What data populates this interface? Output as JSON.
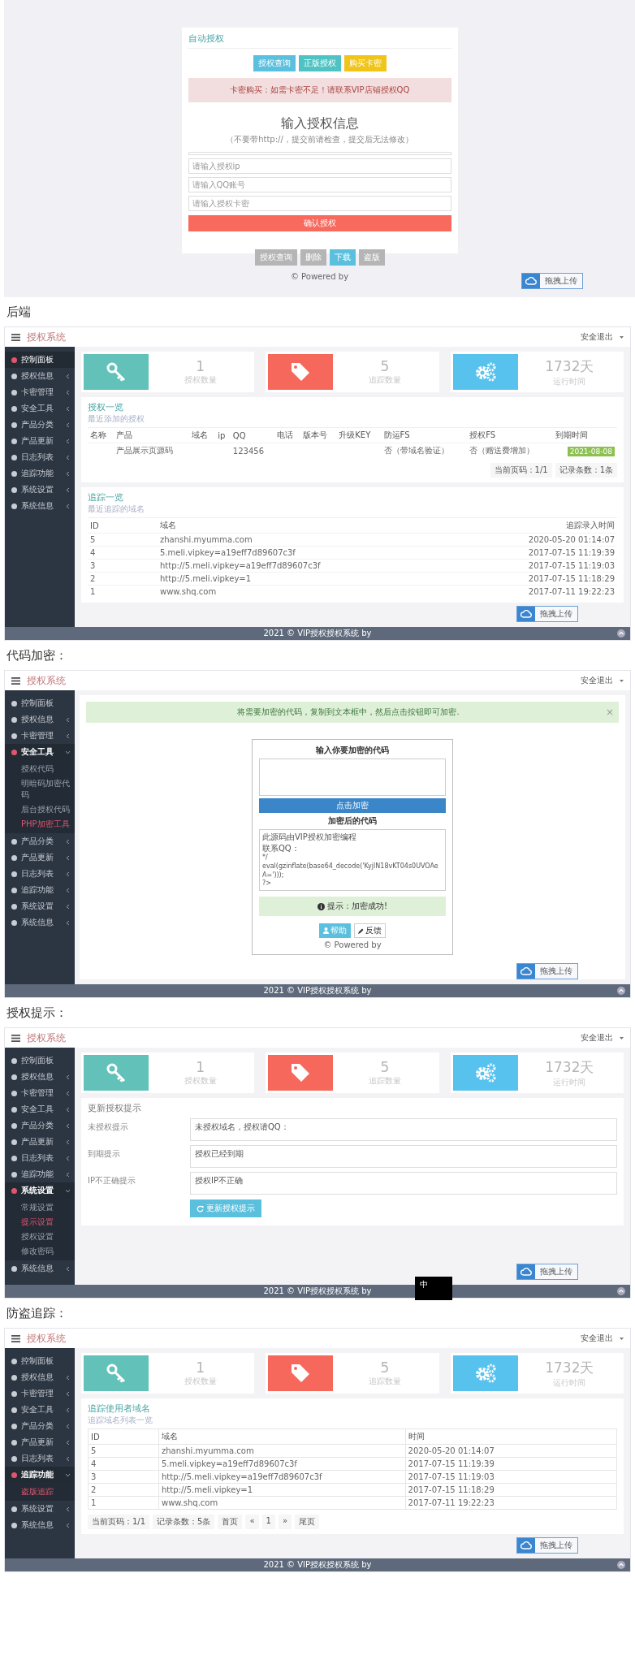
{
  "intro_screen": {
    "card_title": "自动授权",
    "top_buttons": [
      {
        "label": "授权查询",
        "color": "#5bc0de"
      },
      {
        "label": "正版授权",
        "color": "#4fc3c3"
      },
      {
        "label": "购买卡密",
        "color": "#f0c419"
      }
    ],
    "alert": "卡密购买：如需卡密不足！请联系VIP店铺授权QQ",
    "heading": "输入授权信息",
    "subheading": "（不要带http://，提交前请检查，提交后无法修改）",
    "fields": [
      {
        "placeholder": "请输入授权ip"
      },
      {
        "placeholder": "请输入QQ账号"
      },
      {
        "placeholder": "请输入授权卡密"
      }
    ],
    "submit": "确认授权",
    "tabs": [
      {
        "label": "授权查询",
        "selected": false
      },
      {
        "label": "删除",
        "selected": false
      },
      {
        "label": "下载",
        "selected": true
      },
      {
        "label": "盗版",
        "selected": false
      }
    ],
    "footer": "© Powered by",
    "upload": "拖拽上传"
  },
  "sections": [
    {
      "heading": "后端",
      "screen": {
        "brand": "授权系统",
        "logout": "安全退出",
        "menu": [
          {
            "label": "控制面板",
            "kind": "link",
            "selected": true
          },
          {
            "label": "授权信息",
            "kind": "group",
            "selected": false,
            "expanded": false
          },
          {
            "label": "卡密管理",
            "kind": "group",
            "selected": false,
            "expanded": false
          },
          {
            "label": "安全工具",
            "kind": "group",
            "selected": false,
            "expanded": false
          },
          {
            "label": "产品分类",
            "kind": "group",
            "selected": false,
            "expanded": false
          },
          {
            "label": "产品更新",
            "kind": "group",
            "selected": false,
            "expanded": false
          },
          {
            "label": "日志列表",
            "kind": "group",
            "selected": false,
            "expanded": false
          },
          {
            "label": "追踪功能",
            "kind": "group",
            "selected": false,
            "expanded": false
          },
          {
            "label": "系统设置",
            "kind": "group",
            "selected": false,
            "expanded": false
          },
          {
            "label": "系统信息",
            "kind": "group",
            "selected": false,
            "expanded": false
          }
        ],
        "stats": [
          {
            "kind": "key",
            "value": "1",
            "label": "授权数量",
            "color": "#62c2b9"
          },
          {
            "kind": "tag",
            "value": "5",
            "label": "追踪数量",
            "color": "#f5685b"
          },
          {
            "kind": "gears",
            "value": "1732天",
            "label": "运行时间",
            "color": "#58c2ee"
          }
        ],
        "panels": [
          {
            "kind": "auth_table",
            "title": "授权一览",
            "subtitle": "最近添加的授权",
            "columns": [
              "名称",
              "产品",
              "域名",
              "ip",
              "QQ",
              "电话",
              "版本号",
              "升级KEY",
              "防运FS",
              "授权FS",
              "到期时间"
            ],
            "rows": [
              {
                "cells": [
                  null,
                  "产品展示页源码",
                  null,
                  null,
                  "123456",
                  null,
                  null,
                  null,
                  "否（带域名验证）",
                  "否（赠送费增加）"
                ],
                "expiry": "2021-08-08"
              }
            ],
            "pager": [
              "当前页码：1/1",
              "记录条数：1条"
            ]
          },
          {
            "kind": "trace_table",
            "title": "追踪一览",
            "subtitle": "最近追踪的域名",
            "columns": [
              "ID",
              "域名",
              "追踪录入时间"
            ],
            "rows": [
              [
                "5",
                "zhanshi.myumma.com",
                "2020-05-20 01:14:07"
              ],
              [
                "4",
                "5.meli.vipkey=a19eff7d89607c3f",
                "2017-07-15 11:19:39"
              ],
              [
                "3",
                "http://5.meli.vipkey=a19eff7d89607c3f",
                "2017-07-15 11:19:03"
              ],
              [
                "2",
                "http://5.meli.vipkey=1",
                "2017-07-15 11:18:29"
              ],
              [
                "1",
                "www.shq.com",
                "2017-07-11 19:22:23"
              ]
            ]
          }
        ],
        "footer": "2021 © VIP授权授权系统 by",
        "upload": "拖拽上传"
      }
    },
    {
      "heading": "代码加密：",
      "screen": {
        "brand": "授权系统",
        "logout": "安全退出",
        "menu": [
          {
            "label": "控制面板",
            "kind": "link",
            "selected": false,
            "expanded": false
          },
          {
            "label": "授权信息",
            "kind": "group",
            "selected": false,
            "expanded": false
          },
          {
            "label": "卡密管理",
            "kind": "group",
            "selected": false,
            "expanded": false
          },
          {
            "label": "安全工具",
            "kind": "group",
            "selected": true,
            "expanded": true,
            "children": [
              {
                "label": "授权代码",
                "selected": false
              },
              {
                "label": "明暗码加密代码",
                "selected": false
              },
              {
                "label": "后台授权代码",
                "selected": false
              },
              {
                "label": "PHP加密工具",
                "selected": true
              }
            ]
          },
          {
            "label": "产品分类",
            "kind": "group",
            "selected": false,
            "expanded": false
          },
          {
            "label": "产品更新",
            "kind": "group",
            "selected": false,
            "expanded": false
          },
          {
            "label": "日志列表",
            "kind": "group",
            "selected": false,
            "expanded": false
          },
          {
            "label": "追踪功能",
            "kind": "group",
            "selected": false,
            "expanded": false
          },
          {
            "label": "系统设置",
            "kind": "group",
            "selected": false,
            "expanded": false
          },
          {
            "label": "系统信息",
            "kind": "group",
            "selected": false,
            "expanded": false
          }
        ],
        "panels": [
          {
            "kind": "notice",
            "text": "将需要加密的代码，复制到文本框中，然后点击按钮即可加密.",
            "close": "×"
          },
          {
            "kind": "encrypt",
            "title": "输入你要加密的代码",
            "button": "点击加密",
            "result_title": "加密后的代码",
            "code": [
              "此源码由VIP授权加密编程",
              "联系QQ：",
              "*/",
              "eval(gzinflate(base64_decode('KyjlN18vKT04s0UVOAeA=')));",
              "?>"
            ],
            "message": "提示：加密成功!",
            "actions": [
              "帮助",
              "反馈"
            ],
            "footer": "© Powered by"
          }
        ],
        "footer": "2021 © VIP授权授权系统 by",
        "upload": "拖拽上传"
      }
    },
    {
      "heading": "授权提示：",
      "screen": {
        "brand": "授权系统",
        "logout": "安全退出",
        "menu": [
          {
            "label": "控制面板",
            "kind": "link",
            "selected": false,
            "expanded": false
          },
          {
            "label": "授权信息",
            "kind": "group",
            "selected": false,
            "expanded": false
          },
          {
            "label": "卡密管理",
            "kind": "group",
            "selected": false,
            "expanded": false
          },
          {
            "label": "安全工具",
            "kind": "group",
            "selected": false,
            "expanded": false
          },
          {
            "label": "产品分类",
            "kind": "group",
            "selected": false,
            "expanded": false
          },
          {
            "label": "产品更新",
            "kind": "group",
            "selected": false,
            "expanded": false
          },
          {
            "label": "日志列表",
            "kind": "group",
            "selected": false,
            "expanded": false
          },
          {
            "label": "追踪功能",
            "kind": "group",
            "selected": false,
            "expanded": false
          },
          {
            "label": "系统设置",
            "kind": "group",
            "selected": true,
            "expanded": true,
            "children": [
              {
                "label": "常规设置",
                "selected": false
              },
              {
                "label": "提示设置",
                "selected": true
              },
              {
                "label": "授权设置",
                "selected": false
              },
              {
                "label": "修改密码",
                "selected": false
              }
            ]
          },
          {
            "label": "系统信息",
            "kind": "group",
            "selected": false,
            "expanded": false
          }
        ],
        "stats": [
          {
            "kind": "key",
            "value": "1",
            "label": "授权数量",
            "color": "#62c2b9"
          },
          {
            "kind": "tag",
            "value": "5",
            "label": "追踪数量",
            "color": "#f5685b"
          },
          {
            "kind": "gears",
            "value": "1732天",
            "label": "运行时间",
            "color": "#58c2ee"
          }
        ],
        "panels": [
          {
            "kind": "tips",
            "title": "更新授权提示",
            "rows": [
              {
                "label": "未授权提示",
                "value": "未授权域名，授权请QQ："
              },
              {
                "label": "到期提示",
                "value": "授权已经到期"
              },
              {
                "label": "IP不正确提示",
                "value": "授权IP不正确"
              }
            ],
            "button": "更新授权提示"
          }
        ],
        "footer": "2021 © VIP授权授权系统 by",
        "upload": "拖拽上传",
        "ime_indicator": "中"
      }
    },
    {
      "heading": "防盗追踪：",
      "screen": {
        "brand": "授权系统",
        "logout": "安全退出",
        "menu": [
          {
            "label": "控制面板",
            "kind": "link",
            "selected": false,
            "expanded": false
          },
          {
            "label": "授权信息",
            "kind": "group",
            "selected": false,
            "expanded": false
          },
          {
            "label": "卡密管理",
            "kind": "group",
            "selected": false,
            "expanded": false
          },
          {
            "label": "安全工具",
            "kind": "group",
            "selected": false,
            "expanded": false
          },
          {
            "label": "产品分类",
            "kind": "group",
            "selected": false,
            "expanded": false
          },
          {
            "label": "产品更新",
            "kind": "group",
            "selected": false,
            "expanded": false
          },
          {
            "label": "日志列表",
            "kind": "group",
            "selected": false,
            "expanded": false
          },
          {
            "label": "追踪功能",
            "kind": "group",
            "selected": true,
            "expanded": true,
            "children": [
              {
                "label": "盗版追踪",
                "selected": true
              }
            ]
          },
          {
            "label": "系统设置",
            "kind": "group",
            "selected": false,
            "expanded": false
          },
          {
            "label": "系统信息",
            "kind": "group",
            "selected": false,
            "expanded": false
          }
        ],
        "stats": [
          {
            "kind": "key",
            "value": "1",
            "label": "授权数量",
            "color": "#62c2b9"
          },
          {
            "kind": "tag",
            "value": "5",
            "label": "追踪数量",
            "color": "#f5685b"
          },
          {
            "kind": "gears",
            "value": "1732天",
            "label": "运行时间",
            "color": "#58c2ee"
          }
        ],
        "panels": [
          {
            "kind": "trace_grid",
            "title": "追踪使用者域名",
            "subtitle": "追踪域名列表一览",
            "columns": [
              "ID",
              "域名",
              "时间"
            ],
            "rows": [
              [
                "5",
                "zhanshi.myumma.com",
                "2020-05-20 01:14:07"
              ],
              [
                "4",
                "5.meli.vipkey=a19eff7d89607c3f",
                "2017-07-15 11:19:39"
              ],
              [
                "3",
                "http://5.meli.vipkey=a19eff7d89607c3f",
                "2017-07-15 11:19:03"
              ],
              [
                "2",
                "http://5.meli.vipkey=1",
                "2017-07-15 11:18:29"
              ],
              [
                "1",
                "www.shq.com",
                "2017-07-11 19:22:23"
              ]
            ],
            "pager": [
              "当前页码：1/1",
              "记录条数：5条",
              "首页",
              "«",
              "1",
              "»",
              "尾页"
            ]
          }
        ],
        "footer": "2021 © VIP授权授权系统 by",
        "upload": "拖拽上传"
      }
    }
  ]
}
